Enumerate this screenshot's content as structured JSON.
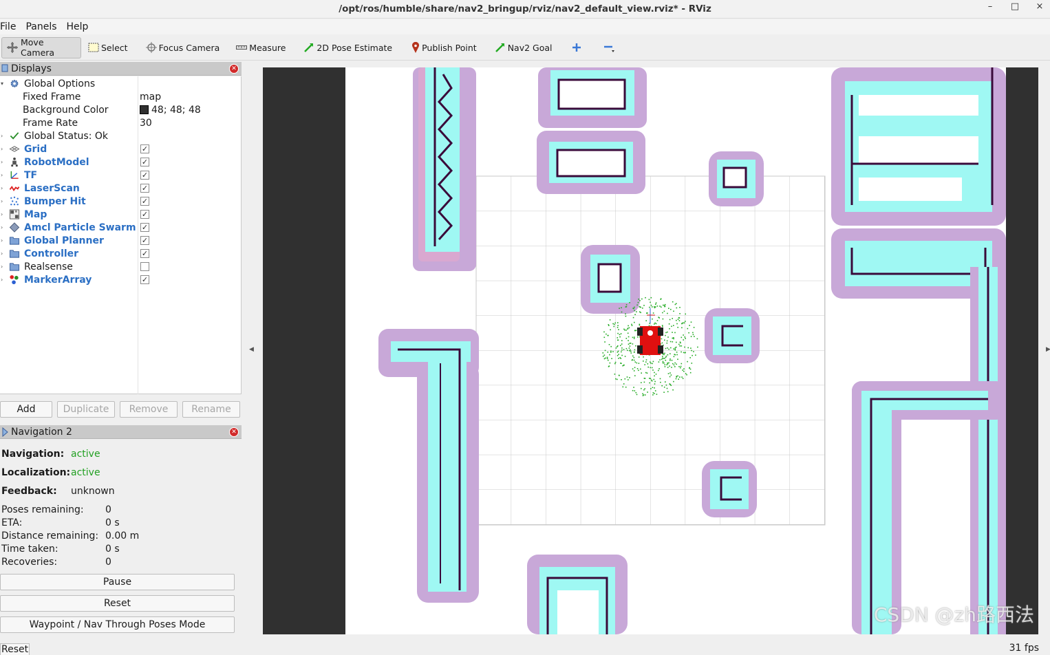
{
  "window": {
    "title": "/opt/ros/humble/share/nav2_bringup/rviz/nav2_default_view.rviz* - RViz",
    "controls": [
      "–",
      "□",
      "×"
    ]
  },
  "menu": [
    "File",
    "Panels",
    "Help"
  ],
  "toolbar": {
    "tools": [
      {
        "label": "Move Camera",
        "icon": "move-camera-icon",
        "active": true
      },
      {
        "label": "Select",
        "icon": "select-icon"
      },
      {
        "label": "Focus Camera",
        "icon": "focus-camera-icon"
      },
      {
        "label": "Measure",
        "icon": "measure-icon"
      },
      {
        "label": "2D Pose Estimate",
        "icon": "pose-estimate-icon",
        "color": "#22aa22"
      },
      {
        "label": "Publish Point",
        "icon": "publish-point-icon",
        "color": "#b5331c"
      },
      {
        "label": "Nav2 Goal",
        "icon": "nav2-goal-icon",
        "color": "#22aa22"
      }
    ]
  },
  "displays": {
    "title": "Displays",
    "global_options": {
      "label": "Global Options",
      "fixed_frame_label": "Fixed Frame",
      "fixed_frame_value": "map",
      "bg_color_label": "Background Color",
      "bg_color_value": "48; 48; 48",
      "bg_color_hex": "#303030",
      "frame_rate_label": "Frame Rate",
      "frame_rate_value": "30"
    },
    "global_status": "Global Status: Ok",
    "items": [
      {
        "label": "Grid",
        "checked": true,
        "icon": "grid-icon"
      },
      {
        "label": "RobotModel",
        "checked": true,
        "icon": "robot-model-icon"
      },
      {
        "label": "TF",
        "checked": true,
        "icon": "tf-icon"
      },
      {
        "label": "LaserScan",
        "checked": true,
        "icon": "laserscan-icon"
      },
      {
        "label": "Bumper Hit",
        "checked": true,
        "icon": "bumper-hit-icon"
      },
      {
        "label": "Map",
        "checked": true,
        "icon": "map-icon"
      },
      {
        "label": "Amcl Particle Swarm",
        "checked": true,
        "icon": "particle-swarm-icon"
      },
      {
        "label": "Global Planner",
        "checked": true,
        "icon": "folder-icon"
      },
      {
        "label": "Controller",
        "checked": true,
        "icon": "folder-icon"
      },
      {
        "label": "Realsense",
        "checked": false,
        "icon": "folder-icon"
      },
      {
        "label": "MarkerArray",
        "checked": true,
        "icon": "marker-array-icon"
      }
    ],
    "buttons": {
      "add": "Add",
      "duplicate": "Duplicate",
      "remove": "Remove",
      "rename": "Rename"
    }
  },
  "navigation": {
    "title": "Navigation 2",
    "navigation_label": "Navigation:",
    "navigation_value": "active",
    "localization_label": "Localization:",
    "localization_value": "active",
    "feedback_label": "Feedback:",
    "feedback_value": "unknown",
    "poses_label": "Poses remaining:",
    "poses_value": "0",
    "eta_label": "ETA:",
    "eta_value": "0 s",
    "distance_label": "Distance remaining:",
    "distance_value": "0.00 m",
    "time_label": "Time taken:",
    "time_value": "0 s",
    "recoveries_label": "Recoveries:",
    "recoveries_value": "0",
    "pause": "Pause",
    "reset": "Reset",
    "waypoint": "Waypoint / Nav Through Poses Mode"
  },
  "status": {
    "reset": "Reset",
    "fps": "31 fps"
  },
  "watermark": "CSDN @zh路西法",
  "colors": {
    "costmap_outer": "#c8a8d8",
    "costmap_inner": "#9ff8f3",
    "obstacle": "#3a0a3a",
    "robot": "#e01010",
    "particles": "#22aa22"
  }
}
